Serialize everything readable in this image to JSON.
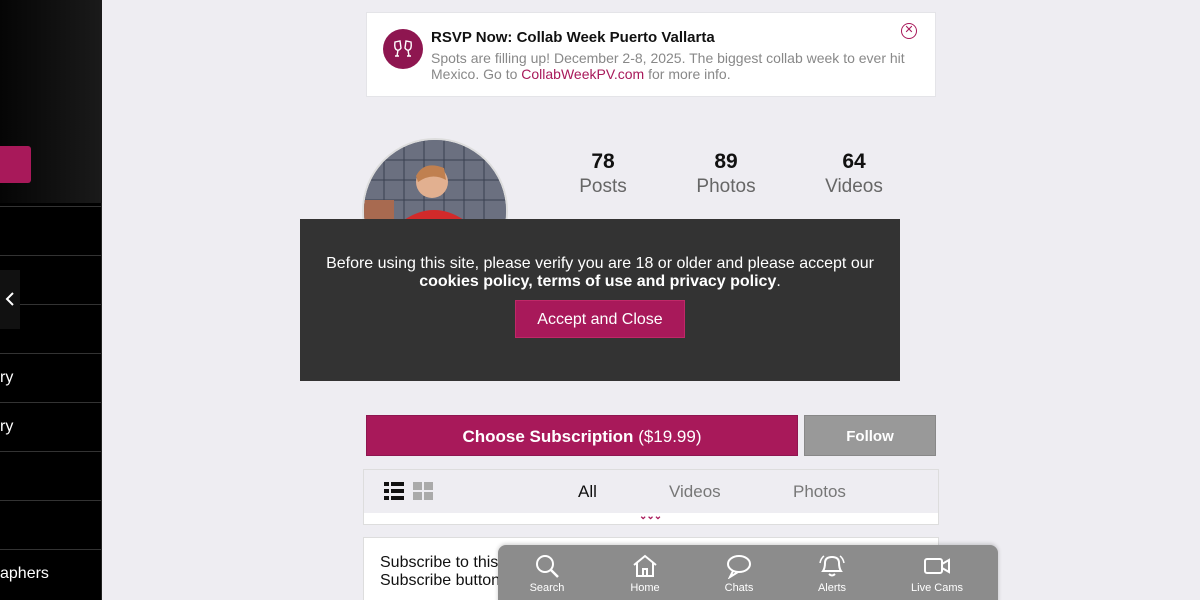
{
  "sidebar": {
    "items": [
      {
        "label": ""
      },
      {
        "label": ""
      },
      {
        "label": ""
      },
      {
        "label": "ry"
      },
      {
        "label": ""
      },
      {
        "label": ""
      },
      {
        "label": "aphers"
      }
    ],
    "collapse_icon": "chevron-left-icon"
  },
  "banner": {
    "title": "RSVP Now: Collab Week Puerto Vallarta",
    "body_before": "Spots are filling up! December 2-8, 2025. The biggest collab week to ever hit Mexico. Go to ",
    "link_text": "CollabWeekPV.com",
    "body_after": " for more info.",
    "avatar_icon": "toast-glasses-icon",
    "close_icon": "close-icon"
  },
  "profile": {
    "stats": [
      {
        "num": "78",
        "label": "Posts"
      },
      {
        "num": "89",
        "label": "Photos"
      },
      {
        "num": "64",
        "label": "Videos"
      }
    ]
  },
  "consent": {
    "text_line1": "Before using this site, please verify you are 18 or older and please accept our",
    "text_bold": "cookies policy, terms of use and privacy policy",
    "text_end": ".",
    "button": "Accept and Close"
  },
  "subscription": {
    "label": "Choose Subscription",
    "price": "($19.99)",
    "follow": "Follow"
  },
  "tabs": {
    "items": [
      "All",
      "Videos",
      "Photos"
    ],
    "active": "All"
  },
  "card": {
    "line1": "Subscribe to this",
    "line2": "Subscribe button"
  },
  "bottom_nav": {
    "items": [
      {
        "label": "Search",
        "icon": "search-icon"
      },
      {
        "label": "Home",
        "icon": "home-icon"
      },
      {
        "label": "Chats",
        "icon": "chat-icon"
      },
      {
        "label": "Alerts",
        "icon": "bell-icon"
      },
      {
        "label": "Live Cams",
        "icon": "video-camera-icon"
      }
    ]
  },
  "colors": {
    "accent": "#a8195a",
    "follow": "#999999",
    "overlay": "#333333",
    "nav": "#8c8c8c"
  }
}
